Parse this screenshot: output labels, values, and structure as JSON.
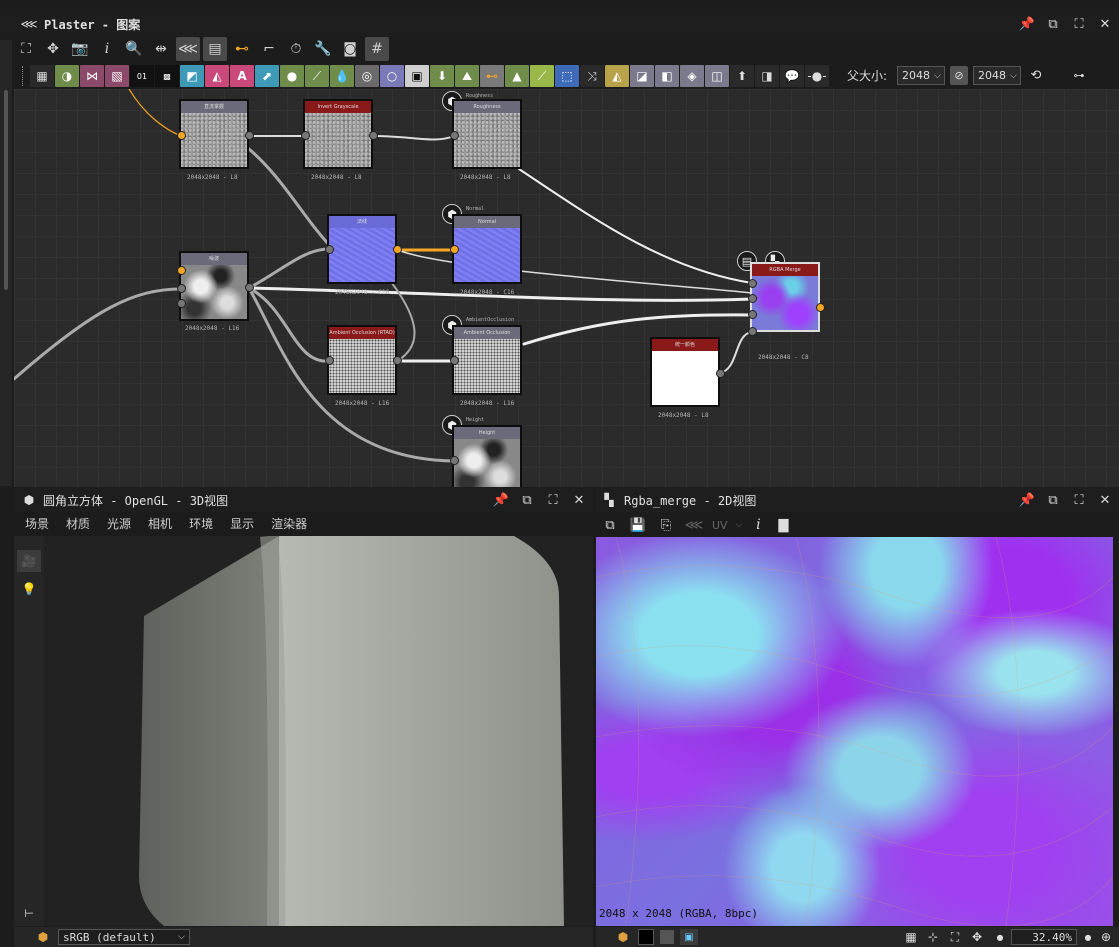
{
  "graph_panel": {
    "title": "Plaster - 图案",
    "parent_size_label": "父大小:",
    "size_a": "2048",
    "size_b": "2048"
  },
  "nodes": [
    {
      "id": "n1",
      "title": "直流掌握",
      "label": "2048x2048 - L8"
    },
    {
      "id": "n2",
      "title": "Invert Grayscale",
      "label": "2048x2048 - L8"
    },
    {
      "id": "n3",
      "title": "Roughness",
      "label": "2048x2048 - L8",
      "top_label": "Roughness"
    },
    {
      "id": "n4",
      "title": "法线",
      "label": "2048x2048 - C16"
    },
    {
      "id": "n5",
      "title": "Normal",
      "label": "2048x2048 - C16",
      "top_label": "Normal"
    },
    {
      "id": "n6",
      "title": "噪波",
      "label": "2048x2048 - L16"
    },
    {
      "id": "n7",
      "title": "Ambient Occlusion (RTAO)",
      "label": "2048x2048 - L16"
    },
    {
      "id": "n8",
      "title": "Ambient Occlusion",
      "label": "2048x2048 - L16",
      "top_label": "AmbientOcclusion"
    },
    {
      "id": "n9",
      "title": "RGBA Merge",
      "label": "2048x2048 - C8"
    },
    {
      "id": "n10",
      "title": "统一颜色",
      "label": "2048x2048 - L8"
    },
    {
      "id": "n11",
      "title": "Height",
      "label": "",
      "top_label": "Height"
    }
  ],
  "viewport3d": {
    "title": "圆角立方体 - OpenGL - 3D视图",
    "menu": [
      "场景",
      "材质",
      "光源",
      "相机",
      "环境",
      "显示",
      "渲染器"
    ],
    "colorspace": "sRGB (default)"
  },
  "viewport2d": {
    "title": "Rgba_merge - 2D视图",
    "uv_label": "UV",
    "info": "2048 x 2048 (RGBA, 8bpc)",
    "zoom": "32.40%"
  },
  "colors": {
    "merge_header": "#8a1a1a",
    "normal_header": "#6b6bd8",
    "node_header_gray": "#6a6a7a",
    "port_orange": "#f5a623"
  }
}
